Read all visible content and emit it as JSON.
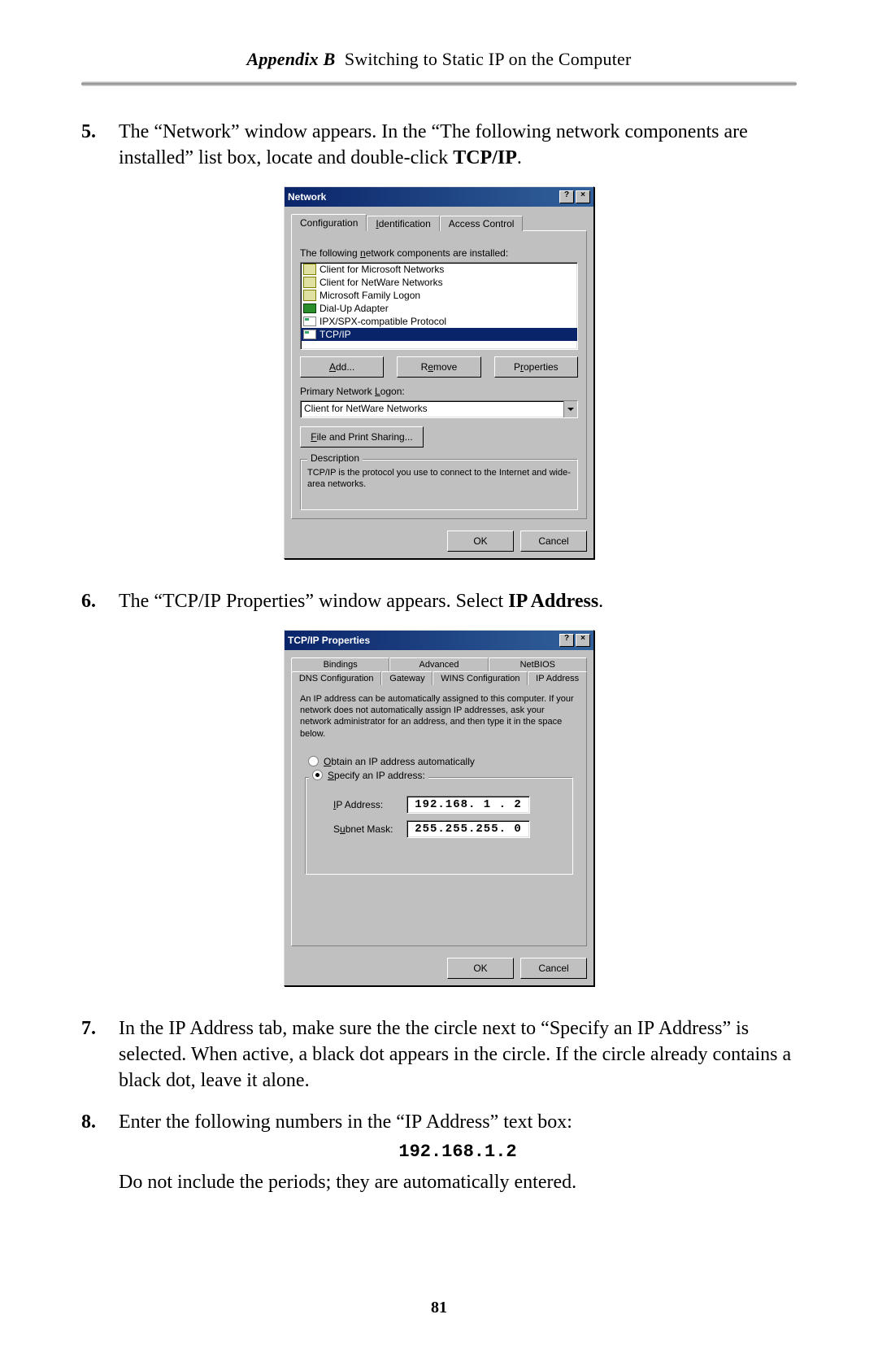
{
  "header": {
    "prefix": "Appendix B",
    "title": "Switching to Static IP on the Computer"
  },
  "steps": {
    "s5": {
      "num": "5.",
      "text_a": "The “Network” window appears. In the “The following network components are installed” list box, locate and double-click ",
      "tcpip": "TCP/IP",
      "text_b": "."
    },
    "s6": {
      "num": "6.",
      "text_a": "The “",
      "sc1": "TCP/IP",
      "text_b": " Properties” window appears. Select ",
      "bold": "IP Address",
      "text_c": "."
    },
    "s7": {
      "num": "7.",
      "text_a": "In the ",
      "sc1": "IP",
      "text_b": " Address tab, make sure the the circle next to “Specify an ",
      "sc2": "IP",
      "text_c": " Address” is selected. When active, a black dot appears in the circle. If the circle already contains a black dot, leave it alone."
    },
    "s8": {
      "num": "8.",
      "text_a": "Enter the following numbers in the “",
      "sc1": "IP",
      "text_b": " Address” text box:",
      "ip": "192.168.1.2",
      "text_c": "Do not include the periods; they are automatically entered."
    }
  },
  "dlg1": {
    "title": "Network",
    "helpbtn": "?",
    "closebtn": "×",
    "tabs": [
      "Configuration",
      "Identification",
      "Access Control"
    ],
    "list_label": "The following network components are installed:",
    "items": [
      "Client for Microsoft Networks",
      "Client for NetWare Networks",
      "Microsoft Family Logon",
      "Dial-Up Adapter",
      "IPX/SPX-compatible Protocol",
      "TCP/IP"
    ],
    "buttons": {
      "add": "Add...",
      "remove": "Remove",
      "props": "Properties"
    },
    "logon_label": "Primary Network Logon:",
    "logon_value": "Client for NetWare Networks",
    "fps": "File and Print Sharing...",
    "desc_legend": "Description",
    "desc_text": "TCP/IP is the protocol you use to connect to the Internet and wide-area networks.",
    "ok": "OK",
    "cancel": "Cancel"
  },
  "dlg2": {
    "title": "TCP/IP Properties",
    "helpbtn": "?",
    "closebtn": "×",
    "tabs_row1": [
      "Bindings",
      "Advanced",
      "NetBIOS"
    ],
    "tabs_row2": [
      "DNS Configuration",
      "Gateway",
      "WINS Configuration",
      "IP Address"
    ],
    "body_text": "An IP address can be automatically assigned to this computer. If your network does not automatically assign IP addresses, ask your network administrator for an address, and then type it in the space below.",
    "radio_auto": "Obtain an IP address automatically",
    "radio_spec": "Specify an IP address:",
    "ip_label": "IP Address:",
    "ip_value": "192.168. 1 . 2",
    "mask_label": "Subnet Mask:",
    "mask_value": "255.255.255. 0",
    "ok": "OK",
    "cancel": "Cancel"
  },
  "page_num": "81"
}
